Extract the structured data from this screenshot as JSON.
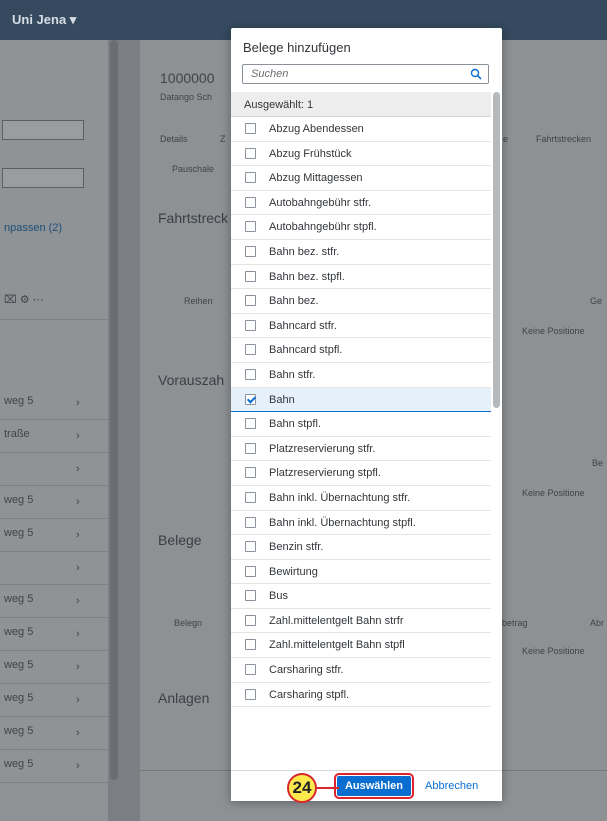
{
  "shell": {
    "title": "Uni Jena ▾"
  },
  "left": {
    "link": "npassen (2)",
    "rows": [
      "weg 5",
      "traße",
      "",
      "weg 5",
      "weg 5",
      "",
      "weg 5",
      "weg 5",
      "weg 5",
      "weg 5",
      "weg 5",
      "weg 5"
    ]
  },
  "right": {
    "id": "1000000",
    "sub": "Datango Sch",
    "tabs": [
      "Details",
      "Z",
      "e",
      "Fahrtstrecken"
    ],
    "subtab": "Pauschale",
    "sections": [
      "Fahrtstreck",
      "Vorauszah",
      "Belege",
      "Anlagen"
    ],
    "texts": {
      "reihen": "Reihen",
      "ge": "Ge",
      "keine1": "Keine Positione",
      "be": "Be",
      "keine2": "Keine Positione",
      "belegn": "Belegn",
      "betrag": "betrag",
      "abr": "Abr",
      "keine3": "Keine Positione"
    }
  },
  "dialog": {
    "title": "Belege hinzufügen",
    "search_placeholder": "Suchen",
    "selected_count": "Ausgewählt: 1",
    "items": [
      {
        "label": "Abzug Abendessen",
        "checked": false
      },
      {
        "label": "Abzug Frühstück",
        "checked": false
      },
      {
        "label": "Abzug Mittagessen",
        "checked": false
      },
      {
        "label": "Autobahngebühr stfr.",
        "checked": false
      },
      {
        "label": "Autobahngebühr stpfl.",
        "checked": false
      },
      {
        "label": "Bahn bez. stfr.",
        "checked": false
      },
      {
        "label": "Bahn bez. stpfl.",
        "checked": false
      },
      {
        "label": "Bahn bez.",
        "checked": false
      },
      {
        "label": "Bahncard stfr.",
        "checked": false
      },
      {
        "label": "Bahncard stpfl.",
        "checked": false
      },
      {
        "label": "Bahn stfr.",
        "checked": false
      },
      {
        "label": "Bahn",
        "checked": true
      },
      {
        "label": "Bahn stpfl.",
        "checked": false
      },
      {
        "label": "Platzreservierung stfr.",
        "checked": false
      },
      {
        "label": "Platzreservierung stpfl.",
        "checked": false
      },
      {
        "label": "Bahn inkl. Übernachtung stfr.",
        "checked": false
      },
      {
        "label": "Bahn inkl. Übernachtung stpfl.",
        "checked": false
      },
      {
        "label": "Benzin stfr.",
        "checked": false
      },
      {
        "label": "Bewirtung",
        "checked": false
      },
      {
        "label": "Bus",
        "checked": false
      },
      {
        "label": "Zahl.mittelentgelt Bahn strfr",
        "checked": false
      },
      {
        "label": "Zahl.mittelentgelt Bahn stpfl",
        "checked": false
      },
      {
        "label": "Carsharing stfr.",
        "checked": false
      },
      {
        "label": "Carsharing stpfl.",
        "checked": false
      }
    ],
    "select_label": "Auswählen",
    "cancel_label": "Abbrechen"
  },
  "annotation": {
    "step": "24"
  },
  "colors": {
    "accent": "#0a6ed1",
    "highlight": "#e0222c",
    "badge": "#fbe94d"
  }
}
